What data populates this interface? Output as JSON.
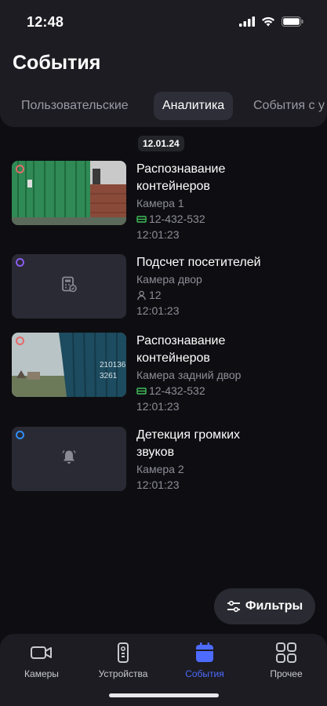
{
  "status_bar": {
    "time": "12:48"
  },
  "header": {
    "title": "События",
    "tabs": [
      {
        "label": "Пользовательские",
        "active": false
      },
      {
        "label": "Аналитика",
        "active": true
      },
      {
        "label": "События с у",
        "active": false
      }
    ]
  },
  "date_chip": "12.01.24",
  "events": [
    {
      "title_line1": "Распознавание",
      "title_line2": "контейнеров",
      "camera": "Камера 1",
      "detail": "12-432-532",
      "detail_icon": "container-icon",
      "time": "12:01:23",
      "dot_color": "#e46a6a",
      "thumb": "green-containers-photo"
    },
    {
      "title_line1": "Подсчет посетителей",
      "title_line2": "",
      "camera": "Камера двор",
      "detail": "12",
      "detail_icon": "person-icon",
      "time": "12:01:23",
      "dot_color": "#8a5cf0",
      "thumb": "calculator-icon"
    },
    {
      "title_line1": "Распознавание",
      "title_line2": "контейнеров",
      "camera": "Камера задний двор",
      "detail": "12-432-532",
      "detail_icon": "container-icon",
      "time": "12:01:23",
      "dot_color": "#e46a6a",
      "thumb": "blue-container-photo"
    },
    {
      "title_line1": "Детекция громких",
      "title_line2": "звуков",
      "camera": "Камера 2",
      "detail": "",
      "detail_icon": "",
      "time": "12:01:23",
      "dot_color": "#2f8cf5",
      "thumb": "bell-icon"
    }
  ],
  "filter_button": {
    "label": "Фильтры",
    "icon": "sliders-icon"
  },
  "bottom_nav": [
    {
      "label": "Камеры",
      "icon": "camera-icon",
      "active": false
    },
    {
      "label": "Устройства",
      "icon": "remote-icon",
      "active": false
    },
    {
      "label": "События",
      "icon": "calendar-icon",
      "active": true
    },
    {
      "label": "Прочее",
      "icon": "grid-icon",
      "active": false
    }
  ],
  "colors": {
    "background": "#0e0e12",
    "surface": "#1c1c22",
    "accent": "#4d6bff",
    "muted_text": "#8d8d98",
    "plate_icon": "#3fbf5a"
  }
}
